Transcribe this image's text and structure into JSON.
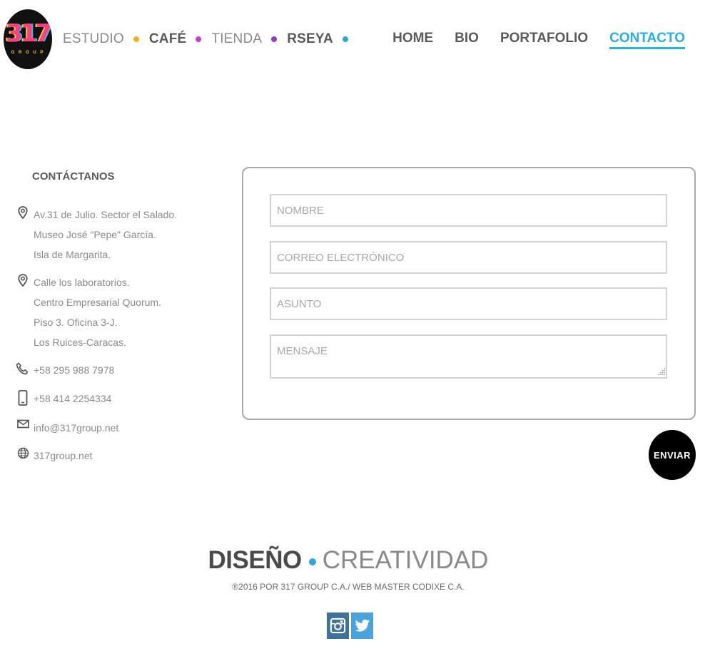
{
  "logo": {
    "number": "317",
    "sub": "G R O U P"
  },
  "brands": [
    {
      "label": "ESTUDIO",
      "dot": "#f3b01d"
    },
    {
      "label": "CAFÉ",
      "dot": "#c541c6"
    },
    {
      "label": "TIENDA",
      "dot": "#8d3bc5"
    },
    {
      "label": "RSEYA",
      "dot": "#29a9dc"
    }
  ],
  "nav": {
    "home": "HOME",
    "bio": "BIO",
    "portfolio": "PORTAFOLIO",
    "contact": "CONTACTO"
  },
  "contact": {
    "title": "CONTÁCTANOS",
    "address1": [
      "Av.31 de Julio. Sector el Salado.",
      "Museo José \"Pepe\" García.",
      "Isla de Margarita."
    ],
    "address2": [
      "Calle los laboratorios.",
      "Centro Empresarial Quorum.",
      "Piso 3. Oficina 3-J.",
      "Los Ruices-Caracas."
    ],
    "phone": "+58 295 988 7978",
    "mobile": "+58 414 2254334",
    "email": "info@317group.net",
    "web": "317group.net"
  },
  "form": {
    "name_placeholder": "NOMBRE",
    "email_placeholder": "CORREO ELECTRÓNICO",
    "subject_placeholder": "ASUNTO",
    "message_placeholder": "MENSAJE",
    "send_label": "ENVIAR"
  },
  "footer": {
    "tagline_bold": "DISEÑO",
    "tagline_dot": "#29a9dc",
    "tagline_light": "CREATIVIDAD",
    "copyright": "®2016 POR 317 GROUP C.A./ WEB MASTER CODIXE C.A."
  },
  "colors": {
    "accent": "#26b0e3",
    "instagram": "#3f729b",
    "twitter": "#4aa3df"
  },
  "icons": [
    "map-pin-icon",
    "phone-icon",
    "mobile-icon",
    "mail-icon",
    "globe-icon",
    "instagram-icon",
    "twitter-icon"
  ]
}
